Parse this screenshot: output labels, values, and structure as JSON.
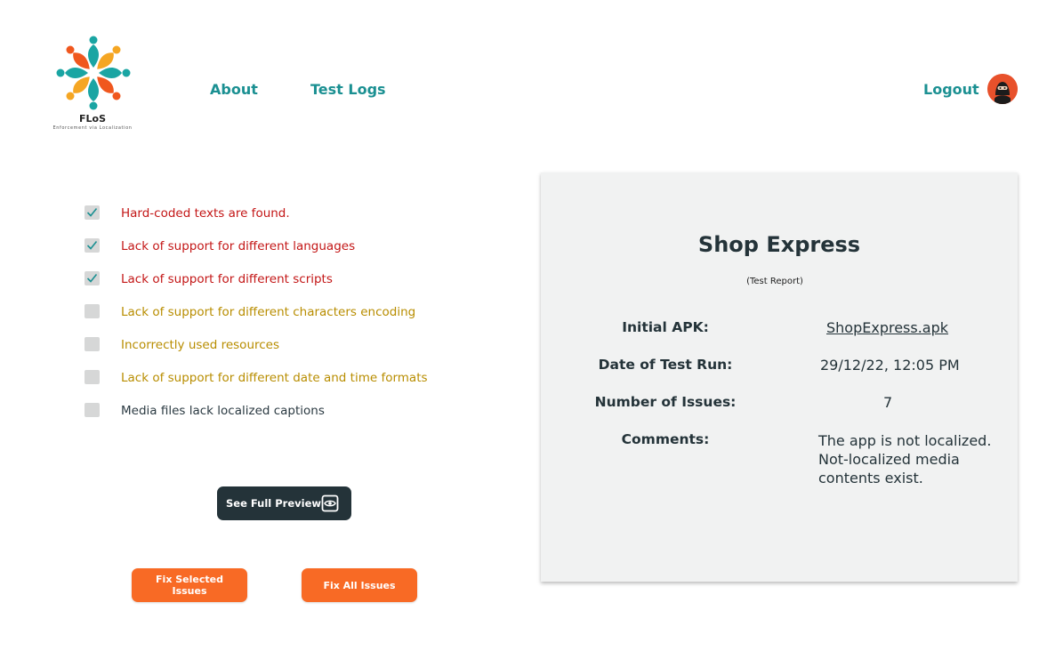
{
  "header": {
    "logo": {
      "name": "FLoS",
      "tagline": "Enforcement via Localization"
    },
    "nav": [
      {
        "label": "About"
      },
      {
        "label": "Test Logs"
      }
    ],
    "logout_label": "Logout",
    "avatar_icon": "ninja-avatar-icon"
  },
  "checklist": {
    "items": [
      {
        "label": "Hard-coded texts are found.",
        "checked": true,
        "color": "#c31616"
      },
      {
        "label": "Lack of support for different languages",
        "checked": true,
        "color": "#c31616"
      },
      {
        "label": "Lack of support for different scripts",
        "checked": true,
        "color": "#c31616"
      },
      {
        "label": "Lack of support for different characters encoding",
        "checked": false,
        "color": "#b88d00"
      },
      {
        "label": "Incorrectly used resources",
        "checked": false,
        "color": "#b88d00"
      },
      {
        "label": "Lack of support for different date and time formats",
        "checked": false,
        "color": "#b88d00"
      },
      {
        "label": "Media files lack localized captions",
        "checked": false,
        "color": "#2b3a42"
      }
    ]
  },
  "actions": {
    "preview_label": "See Full Preview",
    "preview_icon": "eye-icon",
    "fix_selected_label": "Fix Selected Issues",
    "fix_all_label": "Fix All Issues"
  },
  "report": {
    "title": "Shop Express",
    "subtitle": "(Test Report)",
    "initial_apk_label": "Initial APK:",
    "initial_apk_value": "ShopExpress.apk",
    "date_label": "Date of Test Run:",
    "date_value": "29/12/22, 12:05 PM",
    "issues_label": "Number of Issues:",
    "issues_value": "7",
    "comments_label": "Comments:",
    "comments_value": "The app is not localized.\nNot-localized media\ncontents exist."
  },
  "colors": {
    "accent_teal": "#1b9092",
    "button_orange": "#f86a25",
    "button_dark": "#243339",
    "issue_red": "#c31616",
    "issue_gold": "#b88d00"
  }
}
